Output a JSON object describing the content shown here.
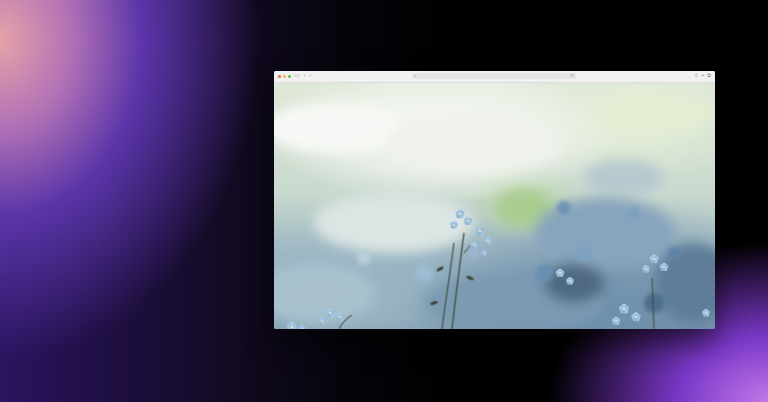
{
  "window": {
    "toolbar": {
      "traffic_lights": [
        "close",
        "minimize",
        "maximize"
      ],
      "sidebar_icon": "sidebar-icon",
      "back_icon": "‹",
      "forward_icon": "›",
      "address_left_icon": "shield-icon",
      "address_right_icon": "reload-icon",
      "right_icons": [
        "share-icon",
        "new-tab-icon",
        "tabs-icon"
      ]
    },
    "content": {
      "image": "forget-me-not-flowers-photo"
    }
  },
  "colors": {
    "close": "#ec6a5e",
    "minimize": "#f4bf4f",
    "maximize": "#61c554",
    "flower_blue": "#8fb5d6",
    "flower_center": "#f0e6a0"
  }
}
